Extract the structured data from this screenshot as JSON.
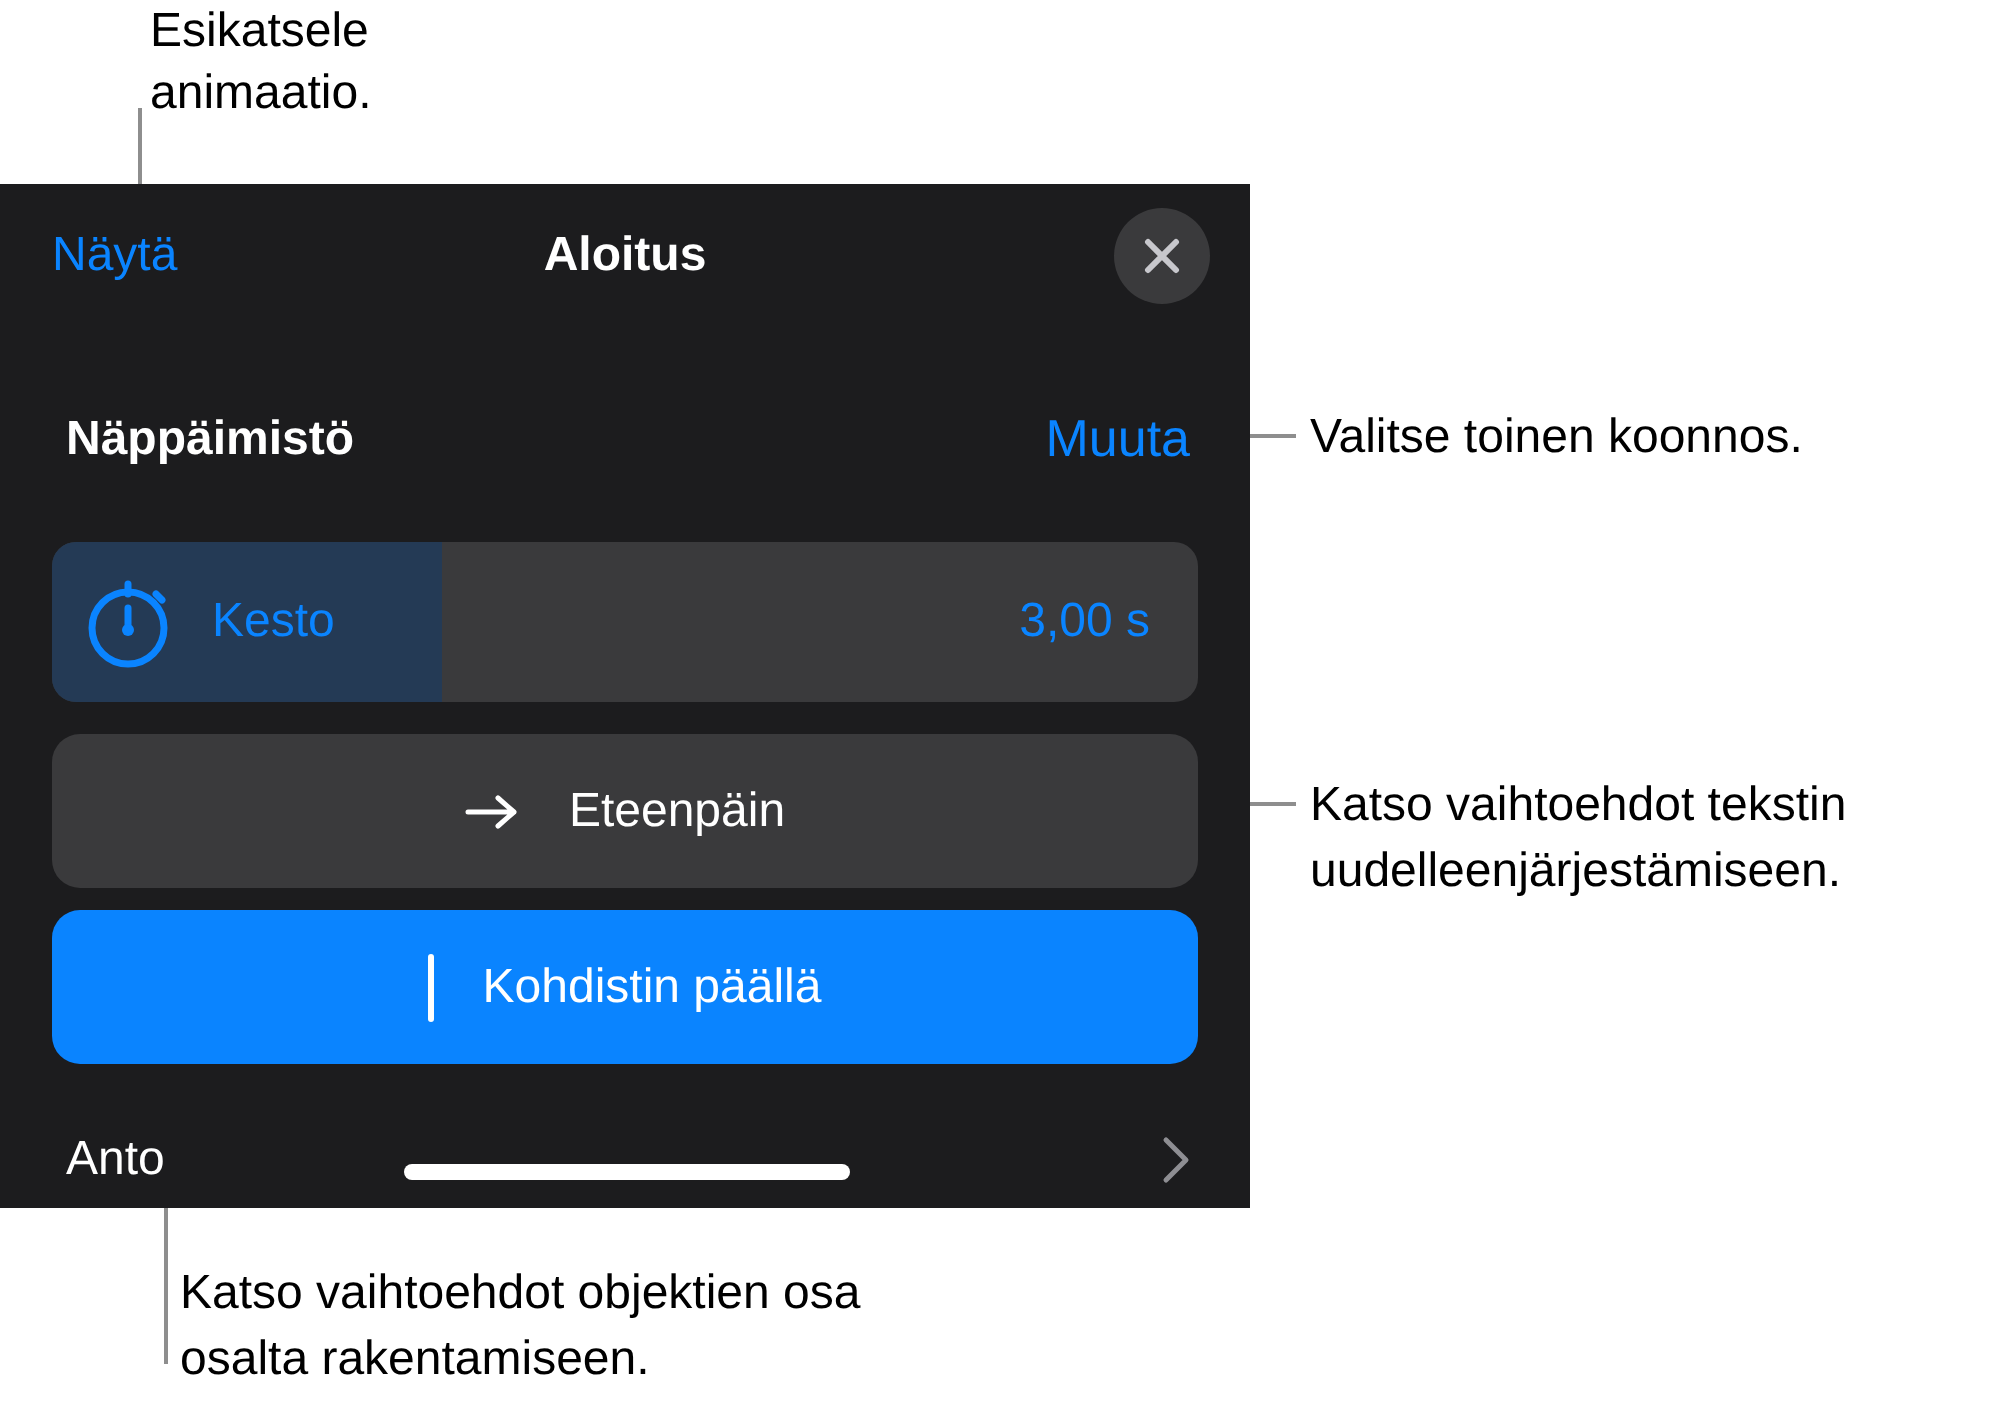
{
  "callouts": [
    {
      "text": "Esikatsele animaatio."
    },
    {
      "text": "Valitse toinen koonnos."
    },
    {
      "text": "Katso vaihtoehdot tekstin uudelleenjärjestämiseen."
    },
    {
      "text": "Katso vaihtoehdot objektien osa osalta rakentamiseen."
    }
  ],
  "panel": {
    "preview_button": "Näytä",
    "title": "Aloitus",
    "build": {
      "label": "Näppäimistö",
      "change_link": "Muuta"
    },
    "duration": {
      "label": "Kesto",
      "value": "3,00 s",
      "level": 0.34
    },
    "options": [
      {
        "kind": "arrow",
        "label": "Eteenpäin",
        "selected": false
      },
      {
        "kind": "cursor",
        "label": "Kohdistin päällä",
        "selected": true
      }
    ],
    "delivery": {
      "label": "Anto"
    }
  }
}
